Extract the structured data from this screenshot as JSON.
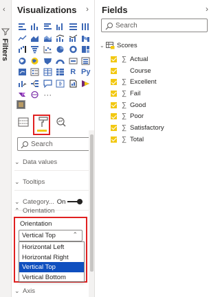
{
  "filters_rail": {
    "label": "Filters",
    "collapse_icon": "chevron-left-icon",
    "filter_icon": "funnel-icon"
  },
  "visualizations": {
    "title": "Visualizations",
    "collapse_icon": "chevron-right-icon",
    "icon_rows": [
      [
        "stacked-bar-chart-icon",
        "stacked-column-chart-icon",
        "clustered-bar-chart-icon",
        "clustered-column-chart-icon",
        "100-stacked-bar-chart-icon",
        "100-stacked-column-chart-icon"
      ],
      [
        "line-chart-icon",
        "area-chart-icon",
        "stacked-area-chart-icon",
        "line-and-stacked-column-icon",
        "line-and-clustered-column-icon",
        "ribbon-chart-icon"
      ],
      [
        "waterfall-chart-icon",
        "funnel-chart-icon",
        "scatter-chart-icon",
        "pie-chart-icon",
        "donut-chart-icon",
        "treemap-icon"
      ],
      [
        "map-icon",
        "filled-map-icon",
        "shape-map-icon",
        "gauge-icon",
        "card-icon",
        "multi-row-card-icon"
      ],
      [
        "kpi-icon",
        "slicer-icon",
        "table-icon",
        "matrix-icon",
        "r-visual-icon",
        "python-visual-icon"
      ],
      [
        "key-influencers-icon",
        "decomposition-tree-icon",
        "qa-icon",
        "smart-narrative-icon",
        "paginated-report-icon",
        "power-apps-icon"
      ],
      [
        "power-automate-icon",
        "arcgis-icon",
        "more-visuals-icon"
      ]
    ],
    "r_text": "R",
    "py_text": "Py",
    "more_text": "···",
    "tabs": {
      "fields_icon": "fields-well-icon",
      "format_icon": "paint-roller-icon",
      "analytics_icon": "magnifier-analytics-icon"
    },
    "search_placeholder": "Search",
    "sections": {
      "data_values": "Data values",
      "tooltips": "Tooltips",
      "category": "Category...",
      "category_toggle": "On",
      "orientation": "Orientation",
      "axis": "Axis"
    },
    "orientation_label": "Orientation",
    "orientation_selected": "Vertical Top",
    "orientation_options": [
      "Horizontal Left",
      "Horizontal Right",
      "Vertical Top",
      "Vertical Bottom"
    ],
    "orientation_highlighted_index": 2
  },
  "fields": {
    "title": "Fields",
    "collapse_icon": "chevron-right-icon",
    "search_placeholder": "Search",
    "table_name": "Scores",
    "items": [
      {
        "name": "Actual",
        "sigma": true
      },
      {
        "name": "Course",
        "sigma": false
      },
      {
        "name": "Excellent",
        "sigma": true
      },
      {
        "name": "Fail",
        "sigma": true
      },
      {
        "name": "Good",
        "sigma": true
      },
      {
        "name": "Poor",
        "sigma": true
      },
      {
        "name": "Satisfactory",
        "sigma": true
      },
      {
        "name": "Total",
        "sigma": true
      }
    ],
    "sigma_glyph": "∑"
  },
  "colors": {
    "accent_yellow": "#f2c811",
    "highlight_red": "#e02020",
    "selection_blue": "#0f4fbf"
  }
}
